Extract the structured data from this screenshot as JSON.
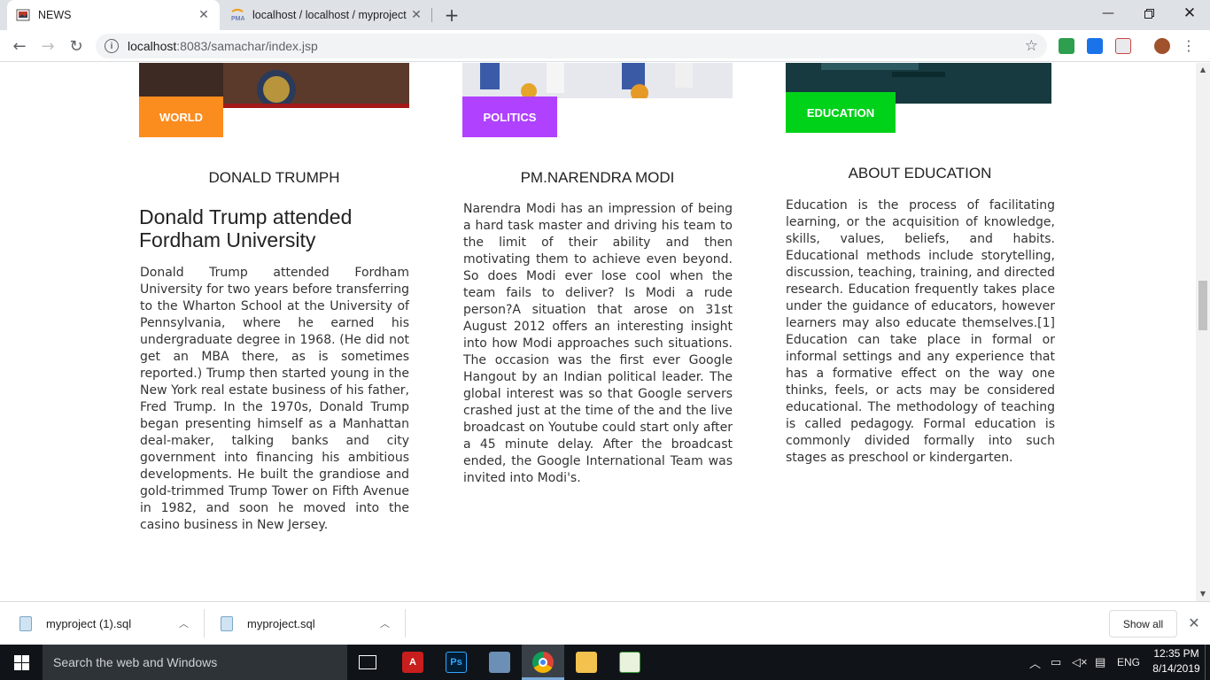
{
  "browser": {
    "tabs": [
      {
        "title": "NEWS",
        "active": true
      },
      {
        "title": "localhost / localhost / myproject",
        "active": false
      }
    ],
    "url_host": "localhost",
    "url_rest": ":8083/samachar/index.jsp"
  },
  "articles": [
    {
      "badge": "WORLD",
      "badge_color": "#fb8c1e",
      "subtitle": "DONALD TRUMPH",
      "headline": "Donald Trump attended Fordham University",
      "body": "Donald Trump attended Fordham University for two years before transferring to the Wharton School at the University of Pennsylvania, where he earned his undergraduate degree in 1968. (He did not get an MBA there, as is sometimes reported.) Trump then started young in the New York real estate business of his father, Fred Trump. In the 1970s, Donald Trump began presenting himself as a Manhattan deal-maker, talking banks and city government into financing his ambitious developments. He built the grandiose and gold-trimmed Trump Tower on Fifth Avenue in 1982, and soon he moved into the casino business in New Jersey."
    },
    {
      "badge": "POLITICS",
      "badge_color": "#b041ff",
      "subtitle": "PM.NARENDRA MODI",
      "body": "Narendra Modi has an impression of being a hard task master and driving his team to the limit of their ability and then motivating them to achieve even beyond. So does Modi ever lose cool when the team fails to deliver? Is Modi a rude person?A situation that arose on 31st August 2012 offers an interesting insight into how Modi approaches such situations. The occasion was the first ever Google Hangout by an Indian political leader. The global interest was so that Google servers crashed just at the time of the and the live broadcast on Youtube could start only after a 45 minute delay. After the broadcast ended, the Google International Team was invited into Modi's."
    },
    {
      "badge": "EDUCATION",
      "badge_color": "#00d21a",
      "subtitle": "ABOUT EDUCATION",
      "body": "Education is the process of facilitating learning, or the acquisition of knowledge, skills, values, beliefs, and habits. Educational methods include storytelling, discussion, teaching, training, and directed research. Education frequently takes place under the guidance of educators, however learners may also educate themselves.[1] Education can take place in formal or informal settings and any experience that has a formative effect on the way one thinks, feels, or acts may be considered educational. The methodology of teaching is called pedagogy. Formal education is commonly divided formally into such stages as preschool or kindergarten."
    }
  ],
  "downloads": [
    {
      "name": "myproject (1).sql"
    },
    {
      "name": "myproject.sql"
    }
  ],
  "shelf": {
    "show_all": "Show all"
  },
  "taskbar": {
    "search_placeholder": "Search the web and Windows",
    "lang": "ENG",
    "time": "12:35 PM",
    "date": "8/14/2019"
  }
}
